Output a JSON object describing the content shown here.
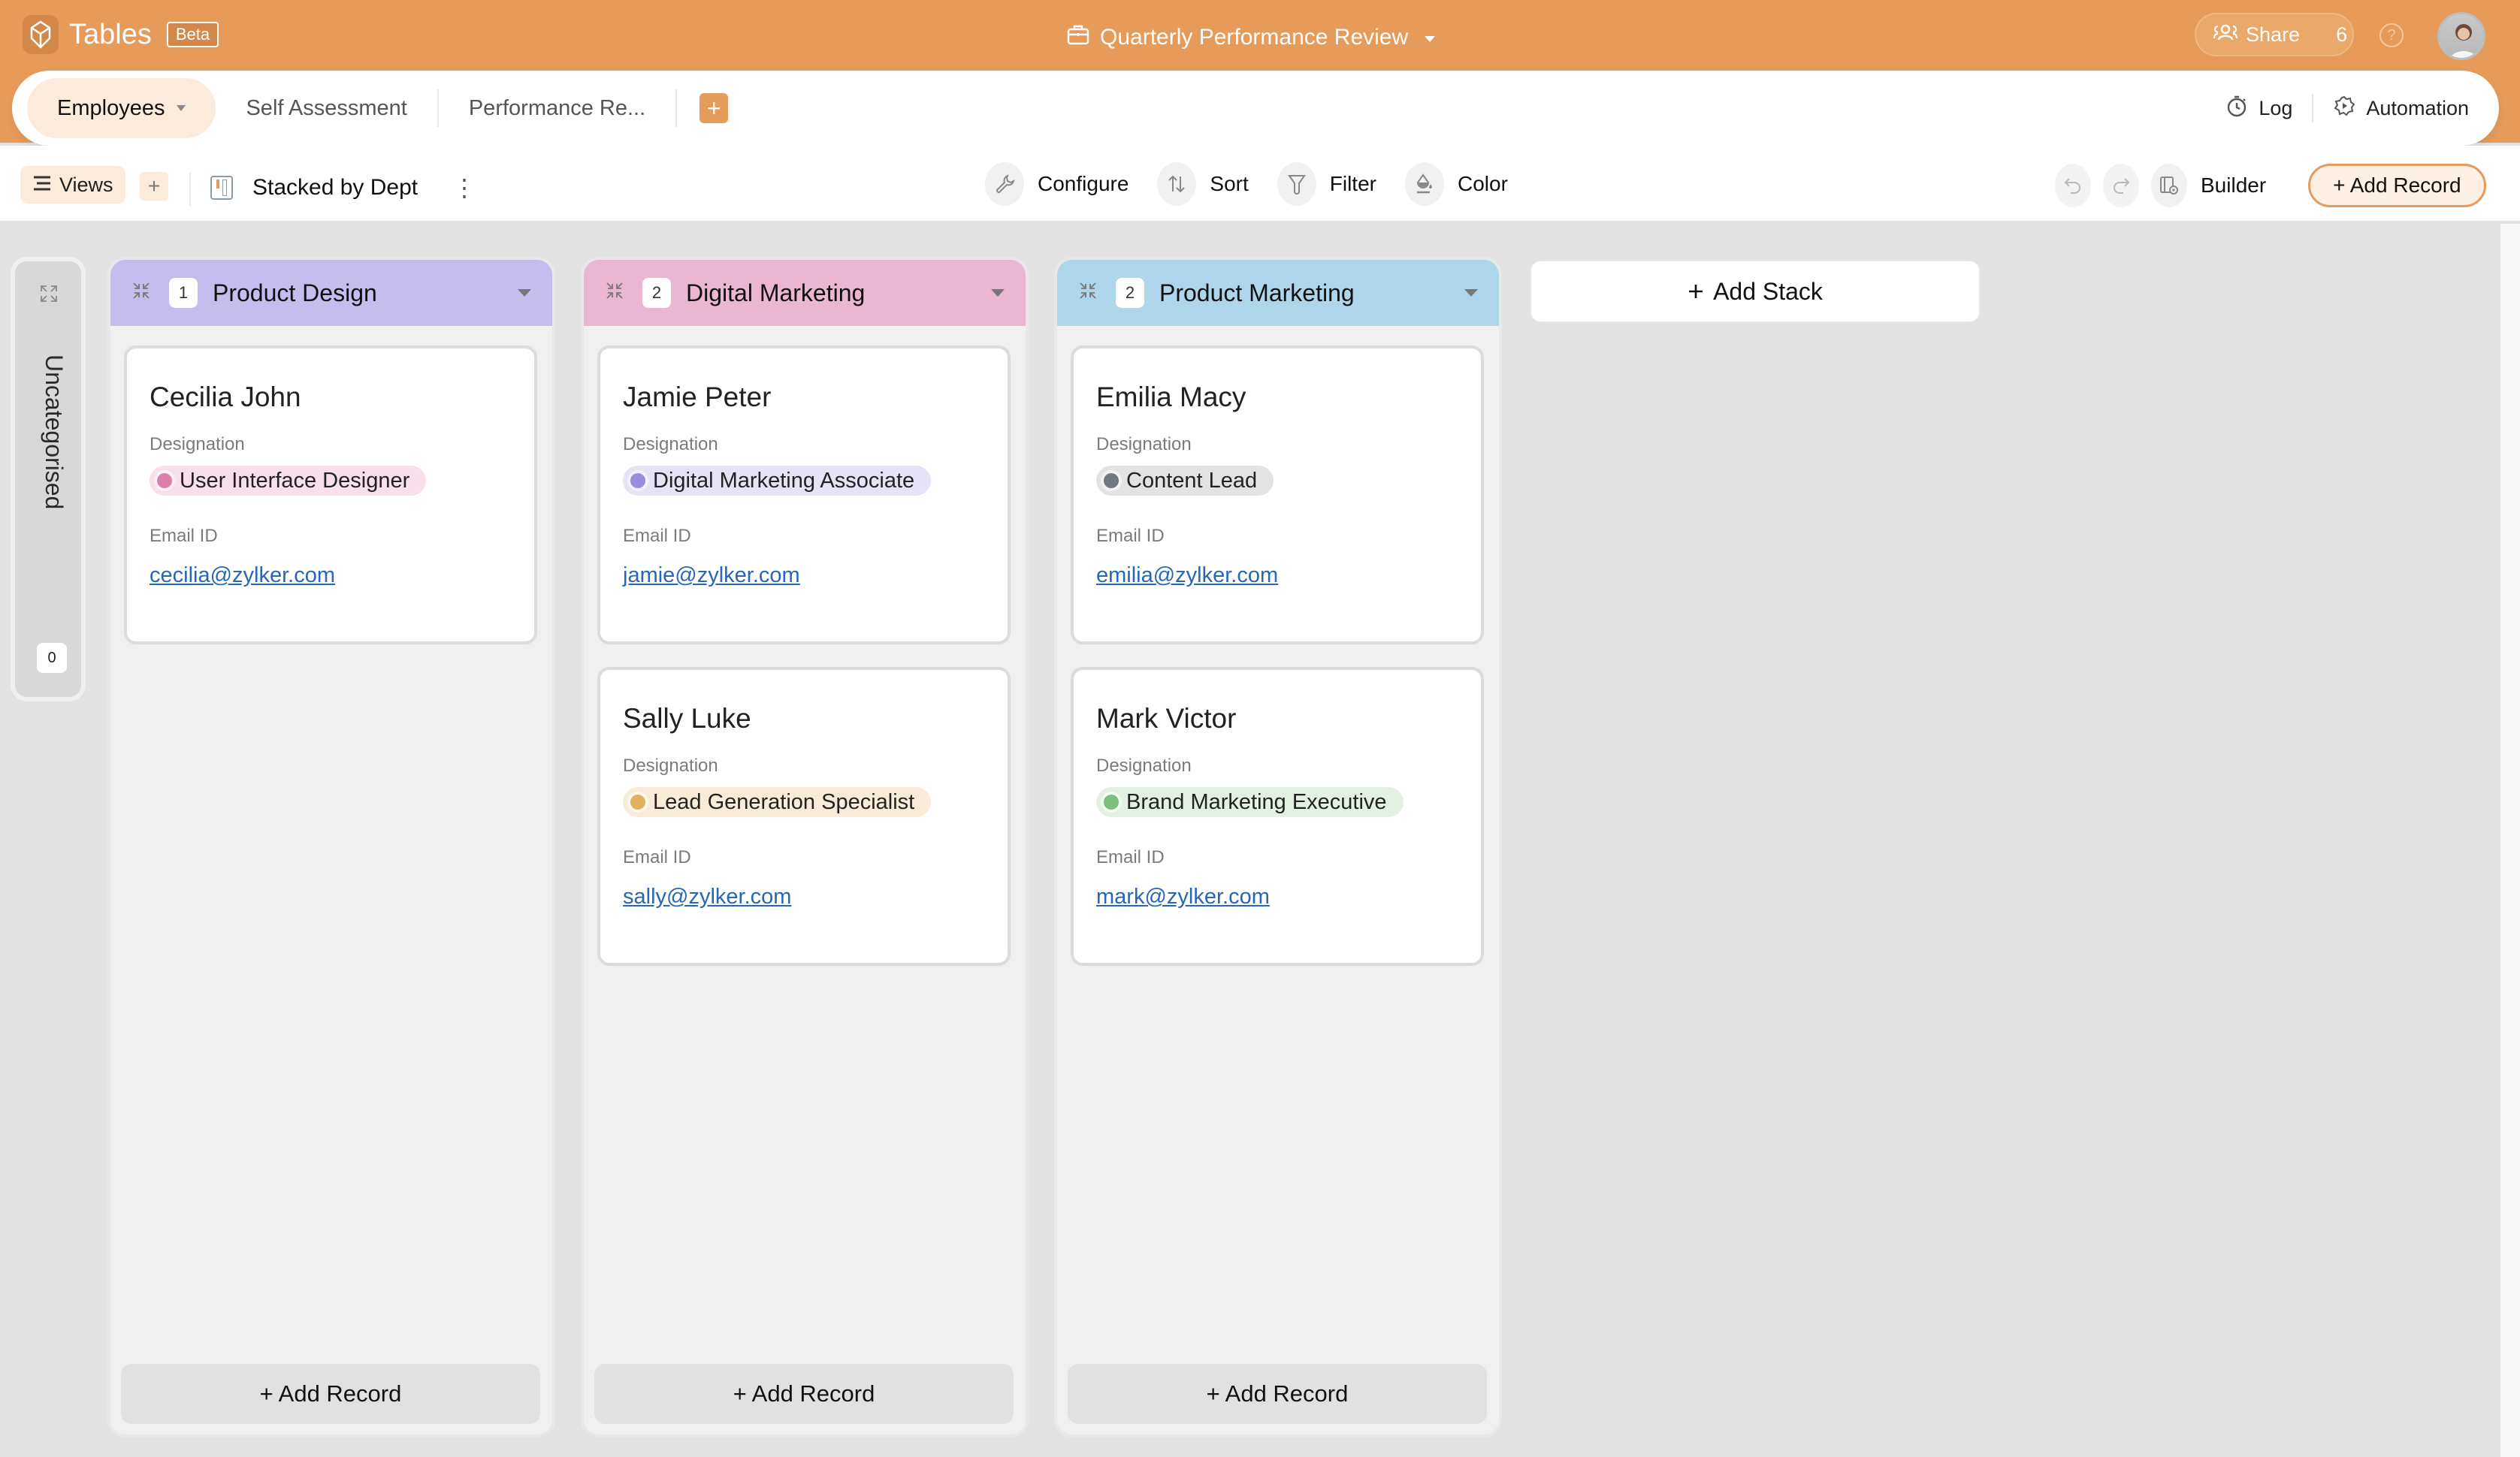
{
  "header": {
    "app_name": "Tables",
    "beta_label": "Beta",
    "doc_title": "Quarterly Performance Review",
    "share_label": "Share",
    "share_count": "6",
    "help_icon": "?"
  },
  "tabs": {
    "items": [
      {
        "label": "Employees",
        "active": true
      },
      {
        "label": "Self Assessment",
        "active": false
      },
      {
        "label": "Performance Re...",
        "active": false
      }
    ],
    "add_label": "+",
    "log_label": "Log",
    "automation_label": "Automation"
  },
  "toolbar": {
    "views_label": "Views",
    "views_add": "+",
    "view_name": "Stacked by Dept",
    "more_icon": "⋮",
    "configure_label": "Configure",
    "sort_label": "Sort",
    "filter_label": "Filter",
    "color_label": "Color",
    "builder_label": "Builder",
    "add_record_label": "+ Add Record"
  },
  "board": {
    "uncategorised": {
      "label": "Uncategorised",
      "count": "0"
    },
    "field_labels": {
      "designation": "Designation",
      "email": "Email ID"
    },
    "stack_add_label": "+ Add Record",
    "add_stack_label": "Add Stack",
    "stacks": [
      {
        "name": "Product Design",
        "count": "1",
        "color": "#c6bdef",
        "cards": [
          {
            "name": "Cecilia John",
            "designation": "User Interface Designer",
            "tag_bg": "#f7dfeb",
            "dot": "#de7eae",
            "email": "cecilia@zylker.com"
          }
        ]
      },
      {
        "name": "Digital Marketing",
        "count": "2",
        "color": "#ebb6d1",
        "cards": [
          {
            "name": "Jamie Peter",
            "designation": "Digital Marketing Associate",
            "tag_bg": "#e7e3f7",
            "dot": "#9a8cdf",
            "email": "jamie@zylker.com"
          },
          {
            "name": "Sally Luke",
            "designation": "Lead Generation Specialist",
            "tag_bg": "#f8ebd8",
            "dot": "#e0b25e",
            "email": "sally@zylker.com"
          }
        ]
      },
      {
        "name": "Product Marketing",
        "count": "2",
        "color": "#aed6ea",
        "cards": [
          {
            "name": "Emilia Macy",
            "designation": "Content Lead",
            "tag_bg": "#e3e3e5",
            "dot": "#737880",
            "email": "emilia@zylker.com"
          },
          {
            "name": "Mark Victor",
            "designation": "Brand Marketing Executive",
            "tag_bg": "#e2f1e1",
            "dot": "#7dc07d",
            "email": "mark@zylker.com"
          }
        ]
      }
    ]
  },
  "colors": {
    "brand": "#e69b5a",
    "link": "#2767b8"
  }
}
